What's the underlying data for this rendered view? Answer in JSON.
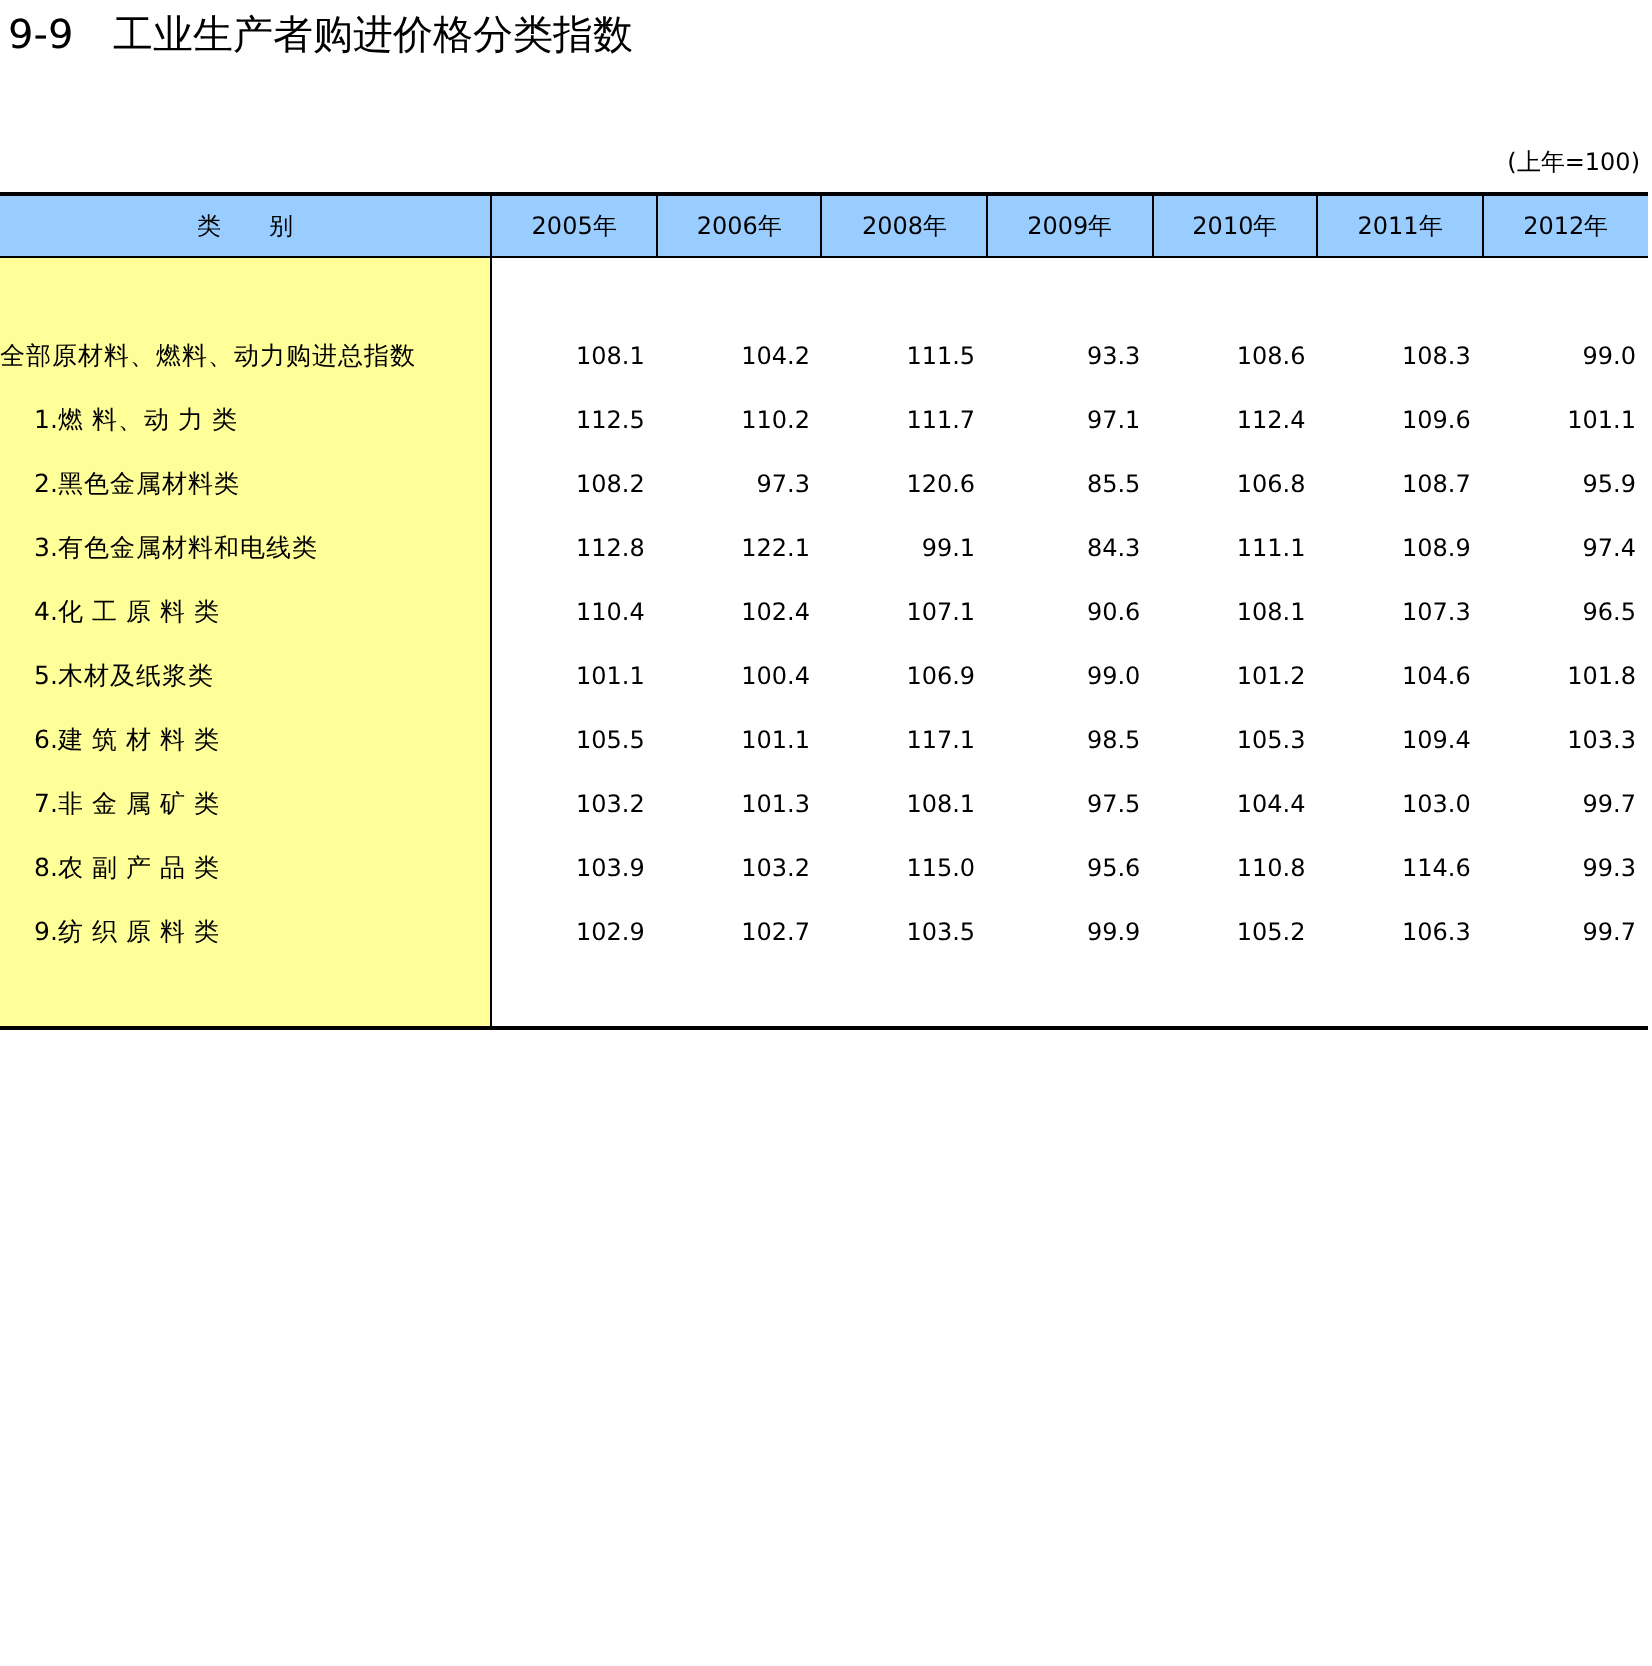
{
  "title": "9-9　工业生产者购进价格分类指数",
  "unit_note": "(上年=100)",
  "table": {
    "columns": [
      "类　　别",
      "2005年",
      "2006年",
      "2008年",
      "2009年",
      "2010年",
      "2011年",
      "2012年"
    ],
    "rows": [
      {
        "label": "全部原材料、燃料、动力购进总指数",
        "values": [
          "108.1",
          "104.2",
          "111.5",
          "93.3",
          "108.6",
          "108.3",
          "99.0"
        ],
        "children": [
          {
            "label": "1.燃 料、动 力 类",
            "values": [
              "112.5",
              "110.2",
              "111.7",
              "97.1",
              "112.4",
              "109.6",
              "101.1"
            ]
          },
          {
            "label": "2.黑色金属材料类",
            "values": [
              "108.2",
              "97.3",
              "120.6",
              "85.5",
              "106.8",
              "108.7",
              "95.9"
            ]
          },
          {
            "label": "3.有色金属材料和电线类",
            "values": [
              "112.8",
              "122.1",
              "99.1",
              "84.3",
              "111.1",
              "108.9",
              "97.4"
            ]
          },
          {
            "label": "4.化 工 原 料 类",
            "values": [
              "110.4",
              "102.4",
              "107.1",
              "90.6",
              "108.1",
              "107.3",
              "96.5"
            ]
          },
          {
            "label": "5.木材及纸浆类",
            "values": [
              "101.1",
              "100.4",
              "106.9",
              "99.0",
              "101.2",
              "104.6",
              "101.8"
            ]
          },
          {
            "label": "6.建 筑 材 料 类",
            "values": [
              "105.5",
              "101.1",
              "117.1",
              "98.5",
              "105.3",
              "109.4",
              "103.3"
            ]
          },
          {
            "label": "7.非 金 属 矿 类",
            "values": [
              "103.2",
              "101.3",
              "108.1",
              "97.5",
              "104.4",
              "103.0",
              "99.7"
            ]
          },
          {
            "label": "8.农 副 产 品 类",
            "values": [
              "103.9",
              "103.2",
              "115.0",
              "95.6",
              "110.8",
              "114.6",
              "99.3"
            ]
          },
          {
            "label": "9.纺 织 原 料 类",
            "values": [
              "102.9",
              "102.7",
              "103.5",
              "99.9",
              "105.2",
              "106.3",
              "99.7"
            ]
          }
        ]
      }
    ]
  }
}
